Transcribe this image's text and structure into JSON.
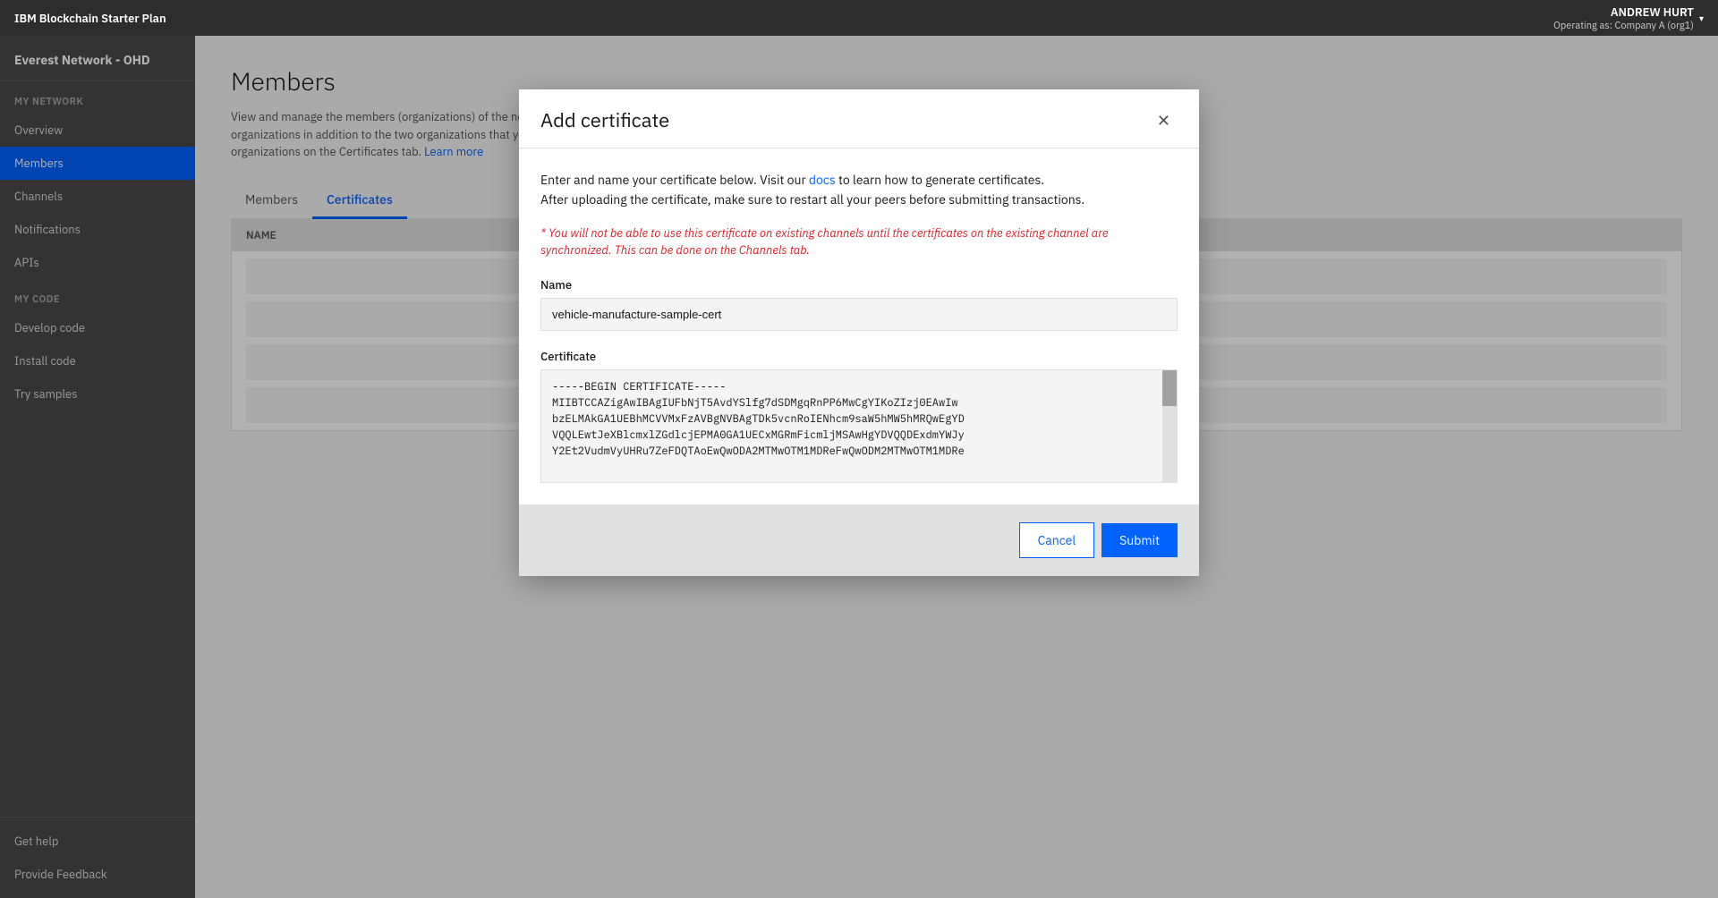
{
  "app": {
    "brand": "IBM Blockchain Starter Plan"
  },
  "user": {
    "name": "ANDREW HURT",
    "role": "Operating as: Company A (org1)",
    "chevron": "▾"
  },
  "sidebar": {
    "network_name": "Everest Network - OHD",
    "sections": [
      {
        "label": "MY NETWORK",
        "items": [
          {
            "id": "overview",
            "label": "Overview",
            "active": false
          },
          {
            "id": "members",
            "label": "Members",
            "active": true
          },
          {
            "id": "channels",
            "label": "Channels",
            "active": false
          },
          {
            "id": "notifications",
            "label": "Notifications",
            "active": false
          },
          {
            "id": "apis",
            "label": "APIs",
            "active": false
          }
        ]
      },
      {
        "label": "MY CODE",
        "items": [
          {
            "id": "develop-code",
            "label": "Develop code",
            "active": false
          },
          {
            "id": "install-code",
            "label": "Install code",
            "active": false
          },
          {
            "id": "try-samples",
            "label": "Try samples",
            "active": false
          }
        ]
      }
    ],
    "bottom_items": [
      {
        "id": "get-help",
        "label": "Get help"
      },
      {
        "id": "provide-feedback",
        "label": "Provide Feedback"
      }
    ]
  },
  "page": {
    "title": "Members",
    "description": "View and manage the members (organizations) of the network on the Members tab. You can invite other organizations to the network or add more organizations in addition to the two organizations that you own by default. You can also view and manage admin certificates that are associated to your organizations on the Certificates tab.",
    "learn_more_label": "Learn more",
    "learn_more_url": "#"
  },
  "tabs": [
    {
      "id": "members",
      "label": "Members",
      "active": false
    },
    {
      "id": "certificates",
      "label": "Certificates",
      "active": true
    }
  ],
  "table": {
    "columns": [
      "NAME"
    ]
  },
  "modal": {
    "title": "Add certificate",
    "close_icon": "✕",
    "intro_line1": "Enter and name your certificate below. Visit our",
    "intro_docs_label": "docs",
    "intro_line2": "to learn how to generate certificates.",
    "intro_line3": "After uploading the certificate, make sure to restart all your peers before submitting transactions.",
    "warning": "* You will not be able to use this certificate on existing channels until the certificates on the existing channel are synchronized. This can be done on the Channels tab.",
    "name_label": "Name",
    "name_value": "vehicle-manufacture-sample-cert",
    "certificate_label": "Certificate",
    "certificate_value": "-----BEGIN CERTIFICATE-----\nMIIB8TCAZigAwIBAgIUFbNjT5AvdYSlfg7dSDMgqRnPP6MwCgYIKoZIzj0EAwIw\nbzELMAkGA1UEBhMCVVMxFzAVBgNVBAgTDk5vcnRoIENhcm9saW5hMW5hMRQwEgYD\nVQQLEwtJeXBlcmxlZGdlcjEPMA0GA1UECxMGRmFicmljMSAwHgYDVQQDExdmYWJy\nY2Et...",
    "cancel_label": "Cancel",
    "submit_label": "Submit"
  }
}
